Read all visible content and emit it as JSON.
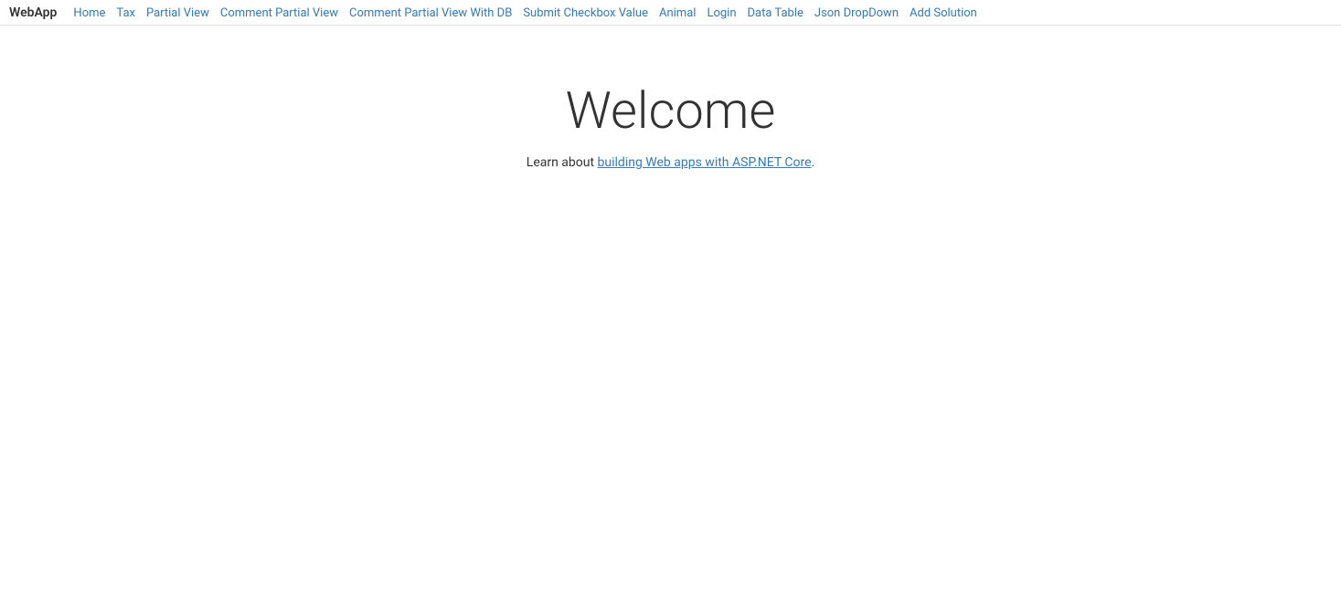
{
  "nav": {
    "brand": "WebApp",
    "links": [
      {
        "label": "Home",
        "id": "home"
      },
      {
        "label": "Tax",
        "id": "tax"
      },
      {
        "label": "Partial View",
        "id": "partial-view"
      },
      {
        "label": "Comment Partial View",
        "id": "comment-partial-view"
      },
      {
        "label": "Comment Partial View With DB",
        "id": "comment-partial-view-db"
      },
      {
        "label": "Submit Checkbox Value",
        "id": "submit-checkbox-value"
      },
      {
        "label": "Animal",
        "id": "animal"
      },
      {
        "label": "Login",
        "id": "login"
      },
      {
        "label": "Data Table",
        "id": "data-table"
      },
      {
        "label": "Json DropDown",
        "id": "json-dropdown"
      },
      {
        "label": "Add Solution",
        "id": "add-solution"
      }
    ]
  },
  "main": {
    "heading": "Welcome",
    "subtext_before": "Learn about ",
    "link_text": "building Web apps with ASP.NET Core",
    "subtext_after": "."
  }
}
